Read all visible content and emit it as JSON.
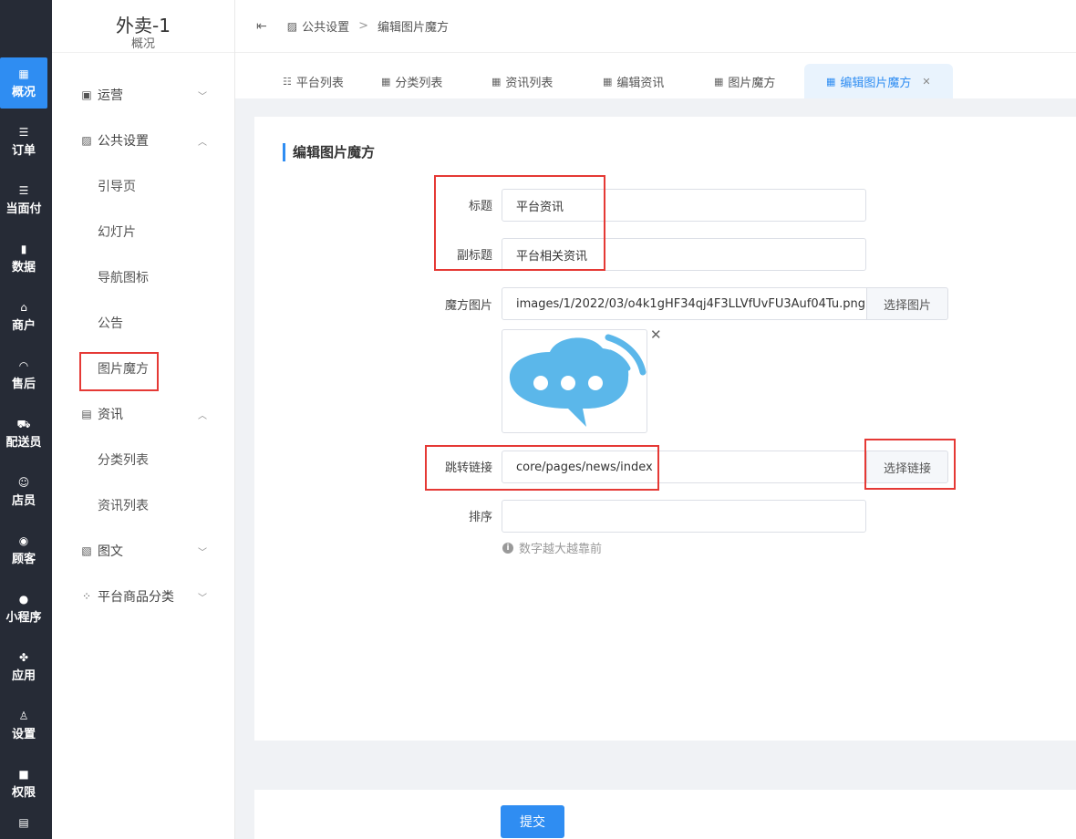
{
  "rail": {
    "items": [
      {
        "label": "概况",
        "icon": "dashboard-icon"
      },
      {
        "label": "订单",
        "icon": "list-icon"
      },
      {
        "label": "当面付",
        "icon": "list-icon"
      },
      {
        "label": "数据",
        "icon": "bar-chart-icon"
      },
      {
        "label": "商户",
        "icon": "store-icon"
      },
      {
        "label": "售后",
        "icon": "headset-icon"
      },
      {
        "label": "配送员",
        "icon": "scooter-icon"
      },
      {
        "label": "店员",
        "icon": "people-icon"
      },
      {
        "label": "顾客",
        "icon": "user-circle-icon"
      },
      {
        "label": "小程序",
        "icon": "wechat-icon"
      },
      {
        "label": "应用",
        "icon": "apps-icon"
      },
      {
        "label": "设置",
        "icon": "user-settings-icon"
      },
      {
        "label": "权限",
        "icon": "lock-icon"
      }
    ]
  },
  "menu": {
    "title": "外卖-1",
    "subtitle": "概况",
    "items": [
      {
        "label": "运营"
      },
      {
        "label": "公共设置"
      },
      {
        "label": "引导页"
      },
      {
        "label": "幻灯片"
      },
      {
        "label": "导航图标"
      },
      {
        "label": "公告"
      },
      {
        "label": "图片魔方"
      },
      {
        "label": "资讯"
      },
      {
        "label": "分类列表"
      },
      {
        "label": "资讯列表"
      },
      {
        "label": "图文"
      },
      {
        "label": "平台商品分类"
      }
    ]
  },
  "header": {
    "breadcrumb_parent": "公共设置",
    "breadcrumb_sep": ">",
    "breadcrumb_current": "编辑图片魔方"
  },
  "tabs": [
    {
      "label": "平台列表"
    },
    {
      "label": "分类列表"
    },
    {
      "label": "资讯列表"
    },
    {
      "label": "编辑资讯"
    },
    {
      "label": "图片魔方"
    },
    {
      "label": "编辑图片魔方"
    }
  ],
  "form": {
    "section_title": "编辑图片魔方",
    "title_label": "标题",
    "title_value": "平台资讯",
    "subtitle_label": "副标题",
    "subtitle_value": "平台相关资讯",
    "image_label": "魔方图片",
    "image_value": "images/1/2022/03/o4k1gHF34qj4F3LLVfUvFU3Auf04Tu.png",
    "choose_image": "选择图片",
    "link_label": "跳转链接",
    "link_value": "core/pages/news/index",
    "choose_link": "选择链接",
    "sort_label": "排序",
    "sort_value": "",
    "sort_hint": "数字越大越靠前",
    "submit": "提交"
  },
  "colors": {
    "accent": "#2f8df2",
    "rail_bg": "#262b36",
    "highlight_red": "#e53935",
    "chat_bubble": "#5bb7ea"
  }
}
